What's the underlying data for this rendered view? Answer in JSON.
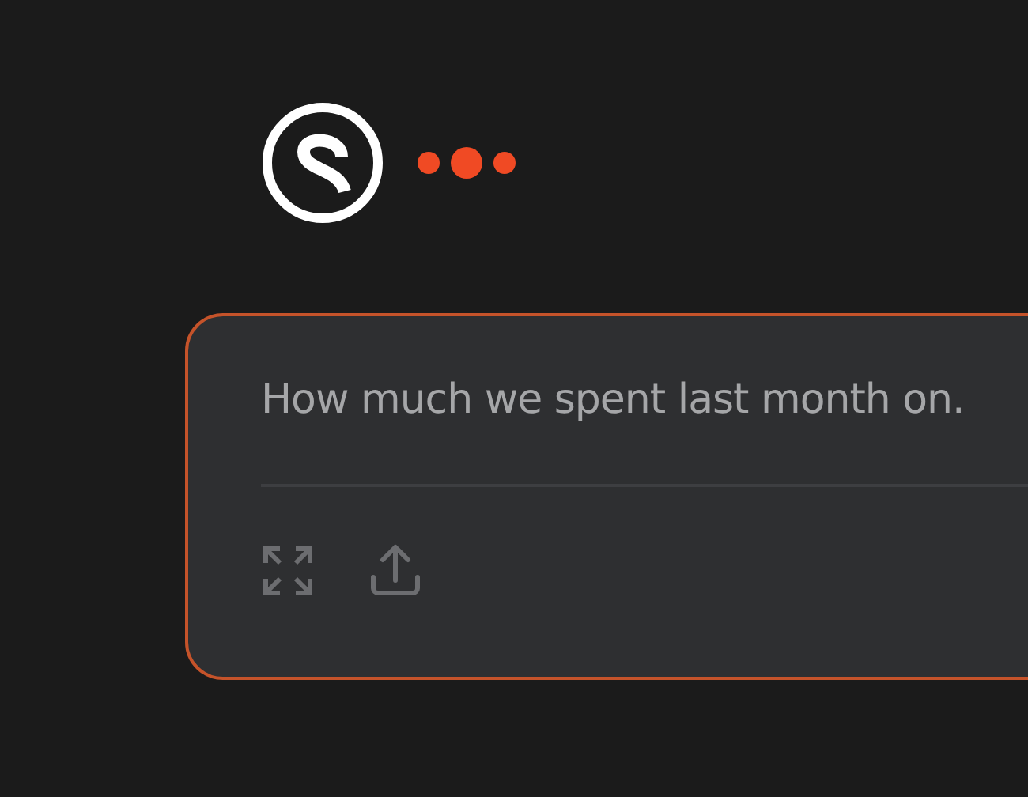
{
  "prompt": {
    "placeholder": "How much we spent last month on."
  }
}
